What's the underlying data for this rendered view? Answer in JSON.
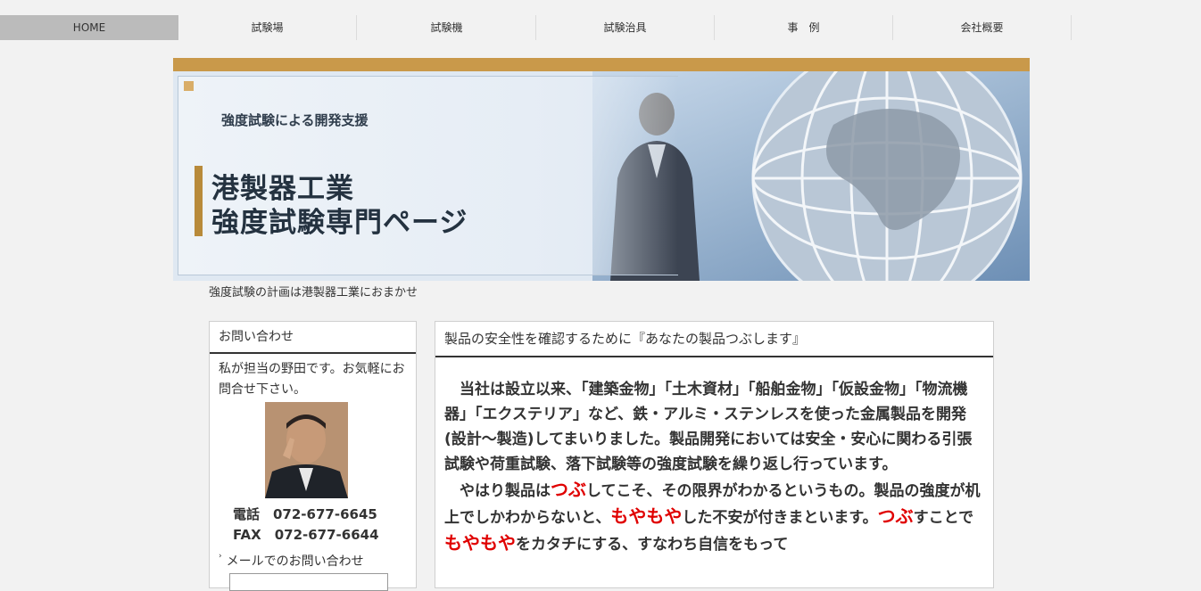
{
  "nav": {
    "items": [
      {
        "label": "HOME",
        "active": true
      },
      {
        "label": "試験場"
      },
      {
        "label": "試験機"
      },
      {
        "label": "試験治具"
      },
      {
        "label": "事　例"
      },
      {
        "label": "会社概要"
      }
    ]
  },
  "banner": {
    "subtitle": "強度試験による開発支援",
    "title_line1": "港製器工業",
    "title_line2": "強度試験専門ページ"
  },
  "tagline": "強度試験の計画は港製器工業におまかせ",
  "sidebar": {
    "heading": "お問い合わせ",
    "intro": "私が担当の野田です。お気軽にお問合せ下さい。",
    "tel": "電話　072-677-6645",
    "fax": "FAX　072-677-6644",
    "mail_label": "メールでのお問い合わせ",
    "mail_icon": "arrow-icon"
  },
  "main": {
    "heading": "製品の安全性を確認するために『あなたの製品つぶします』",
    "para1": "当社は設立以来、「建築金物」「土木資材」「船舶金物」「仮設金物」「物流機器」「エクステリア」など、鉄・アルミ・ステンレスを使った金属製品を開発(設計～製造)してまいりました。製品開発においては安全・安心に関わる引張試験や荷重試験、落下試験等の強度試験を繰り返し行っています。",
    "para2": {
      "t1": "やはり製品は",
      "r1": "つぶ",
      "t2": "してこそ、その限界がわかるというもの。製品の強度が机上でしかわからないと、",
      "r2": "もやもや",
      "t3": "した不安が付きまといます。",
      "r3": "つぶ",
      "t4": "すことで",
      "r4": "もやもや",
      "t5": "をカタチにする、すなわち自信をもって"
    }
  },
  "colors": {
    "accent_gold": "#c9994a",
    "highlight_red": "#e00000"
  }
}
